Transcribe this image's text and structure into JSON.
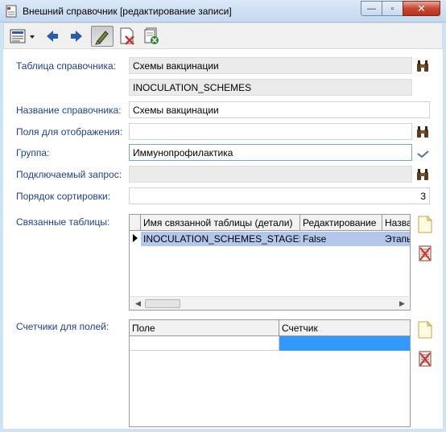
{
  "window": {
    "title": "Внешний справочник [редактирование записи]",
    "buttons": {
      "minimize": "—",
      "maximize": "▫",
      "close": "✕"
    }
  },
  "form": {
    "table_label": "Таблица справочника:",
    "table_value": "Схемы вакцинации",
    "table_code": "INOCULATION_SCHEMES",
    "name_label": "Название справочника:",
    "name_value": "Схемы вакцинации",
    "fields_label": "Поля для отображения:",
    "fields_value": "",
    "group_label": "Группа:",
    "group_value": "Иммунопрофилактика",
    "query_label": "Подключаемый запрос:",
    "query_value": "",
    "sort_label": "Порядок сортировки:",
    "sort_value": "3",
    "related_label": "Связанные таблицы:",
    "counters_label": "Счетчики для полей:"
  },
  "related_grid": {
    "columns": [
      "Имя связанной таблицы (детали)",
      "Редактирование",
      "Назва"
    ],
    "rows": [
      {
        "name": "INOCULATION_SCHEMES_STAGES",
        "edit": "False",
        "title": "Этапы"
      }
    ]
  },
  "counters_grid": {
    "columns": [
      "Поле",
      "Счетчик"
    ]
  },
  "colors": {
    "label": "#1f3f8f",
    "selection": "#b3c7ec",
    "active_cell": "#3399ff"
  }
}
